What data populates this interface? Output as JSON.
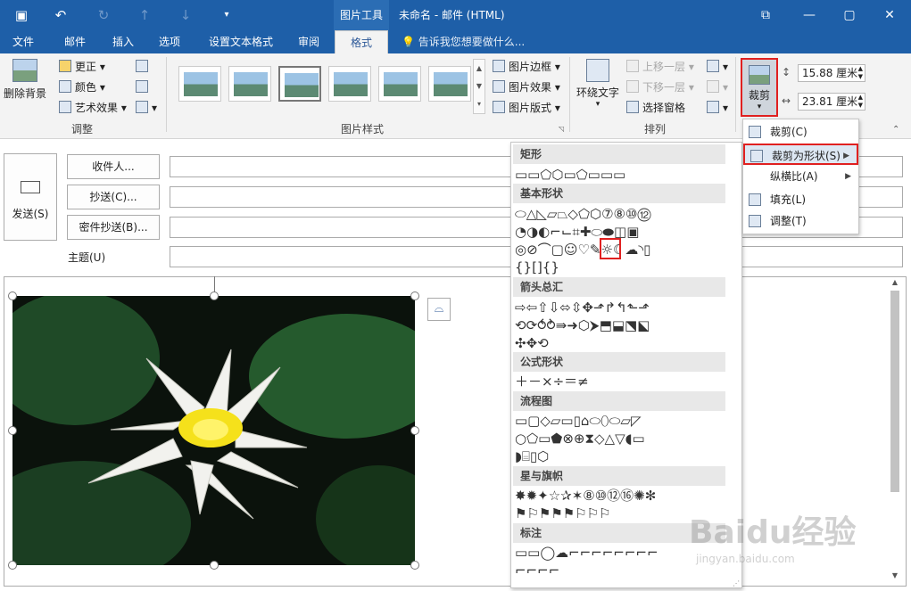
{
  "window": {
    "context_tab": "图片工具",
    "title": "未命名 - 邮件 (HTML)"
  },
  "ribbon_tabs": [
    "文件",
    "邮件",
    "插入",
    "选项",
    "设置文本格式",
    "审阅",
    "格式"
  ],
  "tell_me": "告诉我您想要做什么...",
  "ribbon": {
    "remove_bg": "删除背景",
    "adjust": {
      "label": "调整",
      "corrections": "更正",
      "color": "颜色",
      "artistic": "艺术效果"
    },
    "styles": {
      "label": "图片样式",
      "border": "图片边框",
      "effects": "图片效果",
      "layout": "图片版式"
    },
    "arrange": {
      "label": "排列",
      "wrap": "环绕文字",
      "forward": "上移一层",
      "backward": "下移一层",
      "pane": "选择窗格"
    },
    "size": {
      "crop": "裁剪",
      "height": "15.88 厘米",
      "width": "23.81 厘米"
    }
  },
  "compose": {
    "send": "发送(S)",
    "to": "收件人...",
    "cc": "抄送(C)...",
    "bcc": "密件抄送(B)...",
    "subject": "主题(U)"
  },
  "crop_menu": [
    {
      "label": "裁剪(C)",
      "icon": "crop-icon",
      "submenu": false
    },
    {
      "label": "裁剪为形状(S)",
      "icon": "shape-crop-icon",
      "submenu": true
    },
    {
      "label": "纵横比(A)",
      "icon": "",
      "submenu": true
    },
    {
      "label": "填充(L)",
      "icon": "fill-icon",
      "submenu": false
    },
    {
      "label": "调整(T)",
      "icon": "fit-icon",
      "submenu": false
    }
  ],
  "shape_categories": [
    "矩形",
    "基本形状",
    "箭头总汇",
    "公式形状",
    "流程图",
    "星与旗帜",
    "标注"
  ],
  "shapes": {
    "rect": "▭▭⬠⬡▭⬠▭▭▭",
    "basic1": "⬭△◺▱⏢◇⬠⬡⑦⑧⑩⑫",
    "basic2": "◔◑◐⌐⌙⌗✚⬭⬬◫▣",
    "basic3": "◎⊘⌒▢☺♡✎☼☾☁◝▯",
    "basic4": "{}[]{}",
    "arrow1": "⇨⇦⇧⇩⬄⇳✥⬏↱↰⬑⬏",
    "arrow2": "⟲⟳⥀⥁⇛➜⬡⮞⬒⬓⬔⬕",
    "arrow3": "✣✥⟲",
    "eq": "＋－×÷＝≠",
    "flow1": "▭▢◇▱▭▯⌂⬭⬯⬭⏥◸",
    "flow2": "○⬠▭⬟⊗⊕⧗◇△▽◖▭",
    "flow3": "◗⌸▯⬡",
    "star1": "✸✹✦☆✰✶⑧⑩⑫⑯✺✻",
    "star2": "⚑⚐⚑⚑⚑⚐⚐⚐",
    "callout1": "▭▭◯☁⌐⌐⌐⌐⌐⌐⌐⌐",
    "callout2": "⌐⌐⌐⌐"
  },
  "watermark": "Baidu经验",
  "watermark_sub": "jingyan.baidu.com",
  "colors": {
    "title_blue": "#1e5fa8",
    "highlight_red": "#e02020"
  }
}
